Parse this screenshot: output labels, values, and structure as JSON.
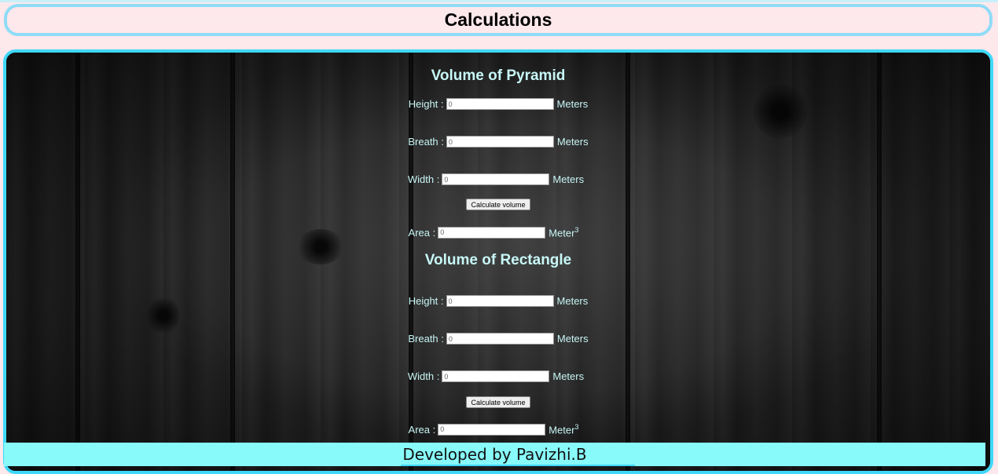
{
  "header": {
    "title": "Calculations"
  },
  "pyramid": {
    "title": "Volume of Pyramid",
    "height": {
      "label": "Height :",
      "value": "0",
      "unit": "Meters"
    },
    "breath": {
      "label": "Breath :",
      "value": "0",
      "unit": "Meters"
    },
    "width": {
      "label": "Width :",
      "value": "0",
      "unit": "Meters"
    },
    "button": "Calculate volume",
    "area": {
      "label": "Area :",
      "value": "0",
      "unit": "Meter",
      "exp": "3"
    }
  },
  "rectangle": {
    "title": "Volume of Rectangle",
    "height": {
      "label": "Height :",
      "value": "0",
      "unit": "Meters"
    },
    "breath": {
      "label": "Breath :",
      "value": "0",
      "unit": "Meters"
    },
    "width": {
      "label": "Width :",
      "value": "0",
      "unit": "Meters"
    },
    "button": "Calculate volume",
    "area": {
      "label": "Area :",
      "value": "0",
      "unit": "Meter",
      "exp": "3"
    }
  },
  "footer": {
    "text": "Developed by Pavizhi.B"
  },
  "colors": {
    "header_border": "#8fdcf7",
    "panel_border": "#3fd8f8",
    "footer_bg": "#88fafa",
    "text_accent": "#c8f5f5",
    "page_bg": "#fde8ec"
  }
}
